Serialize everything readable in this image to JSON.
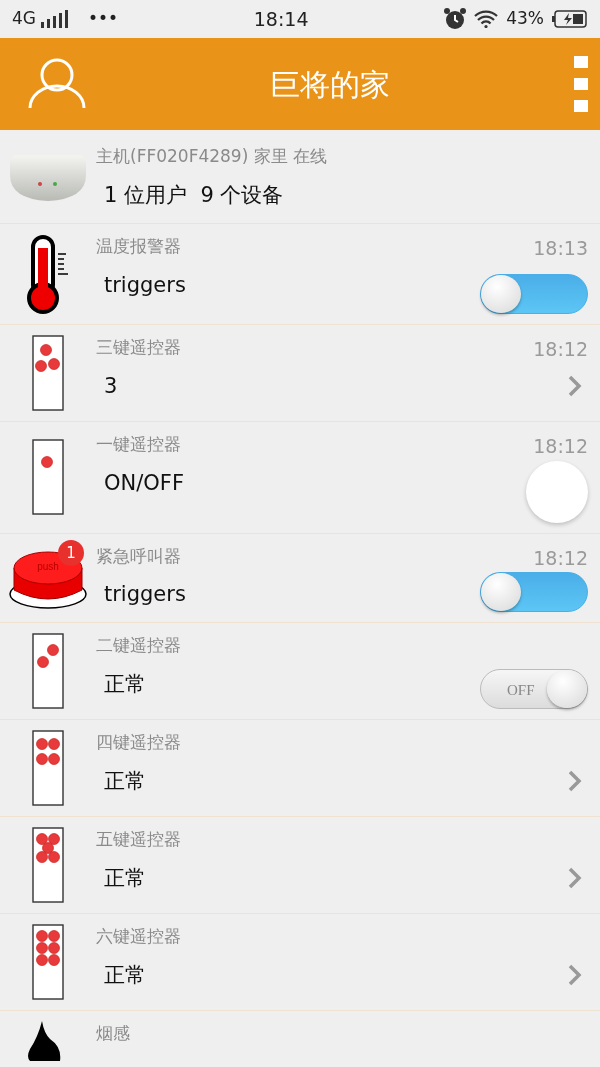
{
  "status_bar": {
    "network": "4G",
    "more": "•••",
    "time": "18:14",
    "battery": "43%"
  },
  "header": {
    "title": "巨将的家"
  },
  "hub": {
    "title": "主机(FF020F4289) 家里 在线",
    "summary": "1 位用户  9 个设备"
  },
  "devices": [
    {
      "kind": "thermometer",
      "name": "温度报警器",
      "time": "18:13",
      "value": "triggers",
      "control": {
        "kind": "blue-switch",
        "on": false
      }
    },
    {
      "kind": "remote-3",
      "name": "三键遥控器",
      "time": "18:12",
      "value": "3",
      "control": {
        "kind": "chevron"
      }
    },
    {
      "kind": "remote-1",
      "name": "一键遥控器",
      "time": "18:12",
      "value": "ON/OFF",
      "control": {
        "kind": "round"
      }
    },
    {
      "kind": "push-button",
      "icon_label": "push",
      "badge": "1",
      "name": "紧急呼叫器",
      "time": "18:12",
      "value": "triggers",
      "control": {
        "kind": "blue-switch",
        "on": false
      }
    },
    {
      "kind": "remote-2",
      "name": "二键遥控器",
      "value": "正常",
      "control": {
        "kind": "labeled-switch",
        "label": "OFF",
        "on": true
      }
    },
    {
      "kind": "remote-4",
      "name": "四键遥控器",
      "value": "正常",
      "control": {
        "kind": "chevron"
      }
    },
    {
      "kind": "remote-5",
      "name": "五键遥控器",
      "value": "正常",
      "control": {
        "kind": "chevron"
      }
    },
    {
      "kind": "remote-6",
      "name": "六键遥控器",
      "value": "正常",
      "control": {
        "kind": "chevron"
      }
    },
    {
      "kind": "flame",
      "name": "烟感"
    }
  ]
}
